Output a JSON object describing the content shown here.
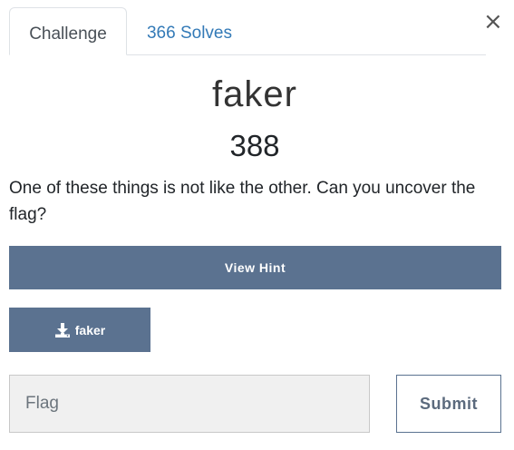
{
  "tabs": [
    {
      "label": "Challenge",
      "active": true
    },
    {
      "label": "366 Solves",
      "active": false
    }
  ],
  "close_label": "×",
  "challenge": {
    "name": "faker",
    "points": "388",
    "description": "One of these things is not like the other. Can you uncover the flag?"
  },
  "hint_button": {
    "label": "View Hint"
  },
  "file_button": {
    "label": "faker",
    "icon": "download-icon"
  },
  "flag_input": {
    "placeholder": "Flag",
    "value": ""
  },
  "submit_button": {
    "label": "Submit"
  },
  "colors": {
    "accent": "#5b7290",
    "link": "#337ab7",
    "input_bg": "#f0f0f0"
  }
}
